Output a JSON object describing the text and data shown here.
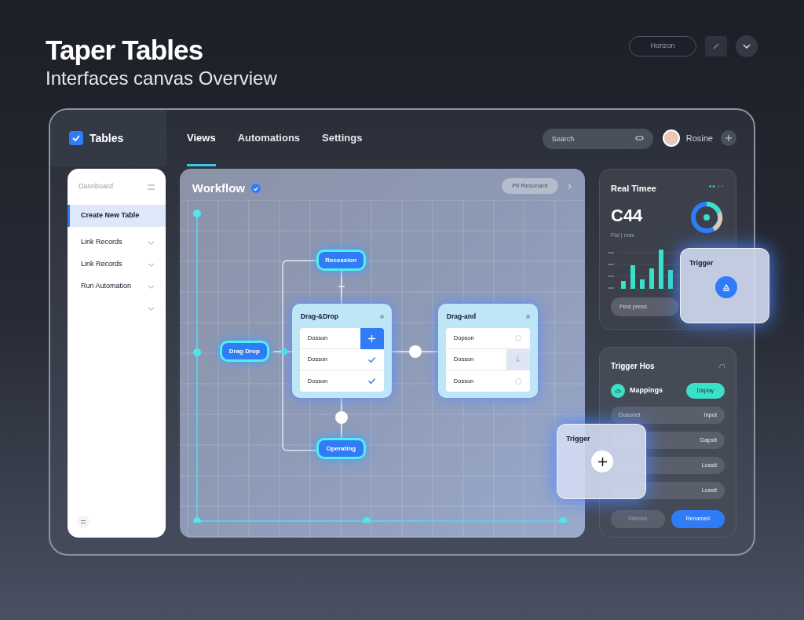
{
  "header": {
    "title": "Taper Tables",
    "subtitle": "Interfaces canvas Overview",
    "button": "Horizon"
  },
  "app": {
    "brand": "Tables",
    "tabs": [
      {
        "label": "Views",
        "selected": true
      },
      {
        "label": "Automations",
        "selected": false
      },
      {
        "label": "Settings",
        "selected": false
      }
    ],
    "search": {
      "placeholder": "Search"
    },
    "user": "Rosine"
  },
  "sidebar": {
    "title": "Dasnboard",
    "items": [
      {
        "label": "Create New Table",
        "selected": true,
        "chevron": false
      },
      {
        "label": "Link Records",
        "selected": false,
        "chevron": true
      },
      {
        "label": "Link Records",
        "selected": false,
        "chevron": true
      },
      {
        "label": "Run Automation",
        "selected": false,
        "chevron": true
      },
      {
        "selected": false,
        "chevron": true
      }
    ]
  },
  "workflow": {
    "title": "Workflow",
    "button": "Pil Resonant",
    "nodes": [
      {
        "label": "Recession"
      },
      {
        "label": "Drag Drop"
      },
      {
        "label": "Operating"
      }
    ],
    "cards": [
      {
        "title": "Drag-&Drop",
        "rows": [
          {
            "label": "Dosson",
            "kind": "add"
          },
          {
            "label": "Dosson",
            "kind": "toggle",
            "checked": true
          },
          {
            "label": "Dosson",
            "kind": "toggle",
            "checked": true
          }
        ]
      },
      {
        "title": "Drag-and",
        "rows": [
          {
            "label": "Dopson",
            "kind": "toggle",
            "checked": false
          },
          {
            "label": "Dosson",
            "kind": "arrow"
          },
          {
            "label": "Dosson",
            "kind": "toggle",
            "checked": false
          }
        ]
      }
    ]
  },
  "realtime": {
    "title": "Real Timee",
    "value": "C44",
    "caption": "Fisl | mee",
    "button": "Find press"
  },
  "trigger_panel": {
    "title": "Trigger Hos",
    "mapping": "Mappings",
    "badge": "Display",
    "rows": [
      {
        "label": "Dossnet",
        "value": "Inpot"
      },
      {
        "value": "Dapsit"
      },
      {
        "value": "Lossit"
      },
      {
        "value": "Lossit"
      }
    ],
    "buttons": [
      {
        "label": "Dismiss",
        "kind": "secondary"
      },
      {
        "label": "Renamed",
        "kind": "primary"
      }
    ]
  },
  "floating_cards": [
    {
      "title": "Trigger",
      "kind": "upload"
    },
    {
      "title": "Trigger",
      "kind": "add"
    }
  ]
}
